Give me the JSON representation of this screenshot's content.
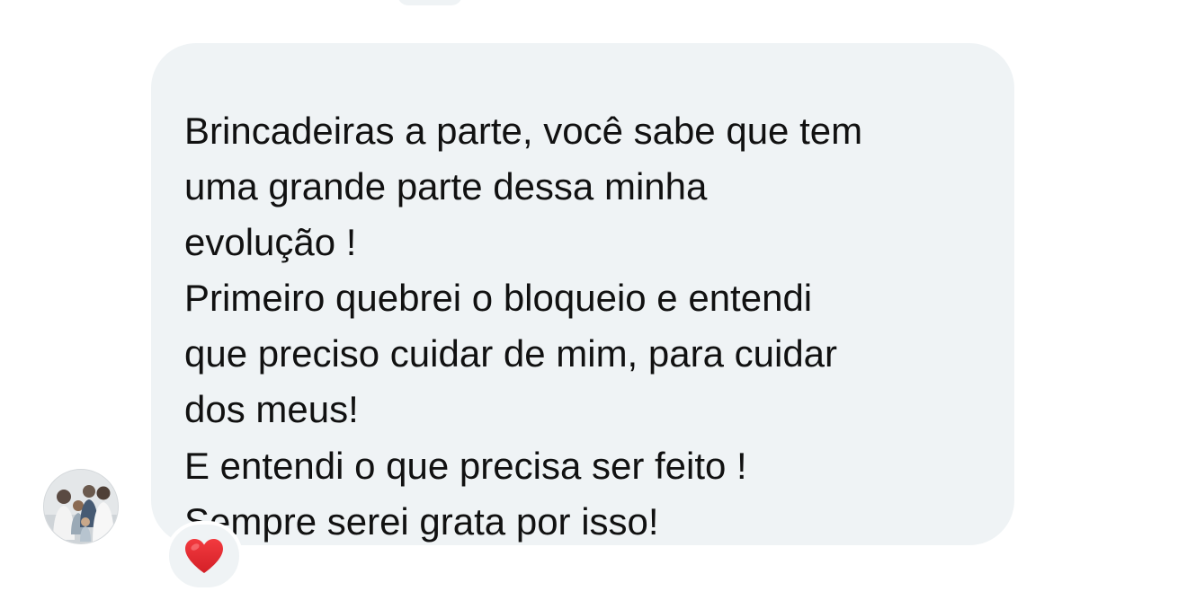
{
  "message": {
    "lines": [
      "Brincadeiras a parte, você sabe que tem",
      "uma grande parte dessa minha",
      "evolução !",
      "Primeiro quebrei o bloqueio e entendi",
      "que preciso cuidar de mim, para cuidar",
      "dos meus!",
      "E entendi o que precisa ser feito !",
      "Sempre serei grata por isso!"
    ],
    "bubble_color": "#eff3f5",
    "text_color": "#111111"
  },
  "sender": {
    "avatar_icon": "profile-photo"
  },
  "reaction": {
    "icon": "red-heart-icon",
    "color": "#e0242e"
  }
}
